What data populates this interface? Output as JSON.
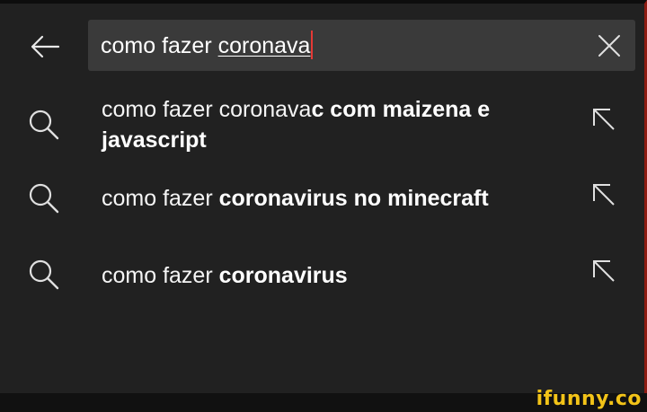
{
  "search": {
    "prefix": "como fazer ",
    "typed": "coronava",
    "back_icon": "arrow-left-icon",
    "clear_icon": "close-icon"
  },
  "suggestions": [
    {
      "plain": "como fazer coronava",
      "bold": "c com maizena e javascript",
      "icon": "search-icon",
      "fill_icon": "arrow-up-left-icon"
    },
    {
      "plain": "como fazer ",
      "bold": "coronavirus no minecraft",
      "icon": "search-icon",
      "fill_icon": "arrow-up-left-icon"
    },
    {
      "plain": "como fazer ",
      "bold": "coronavirus",
      "icon": "search-icon",
      "fill_icon": "arrow-up-left-icon"
    }
  ],
  "watermark": {
    "text": "ifunny.co"
  },
  "colors": {
    "background": "#212121",
    "search_box": "#3a3a3a",
    "text": "#ffffff",
    "caret": "#e53935",
    "watermark": "#f2c318"
  }
}
